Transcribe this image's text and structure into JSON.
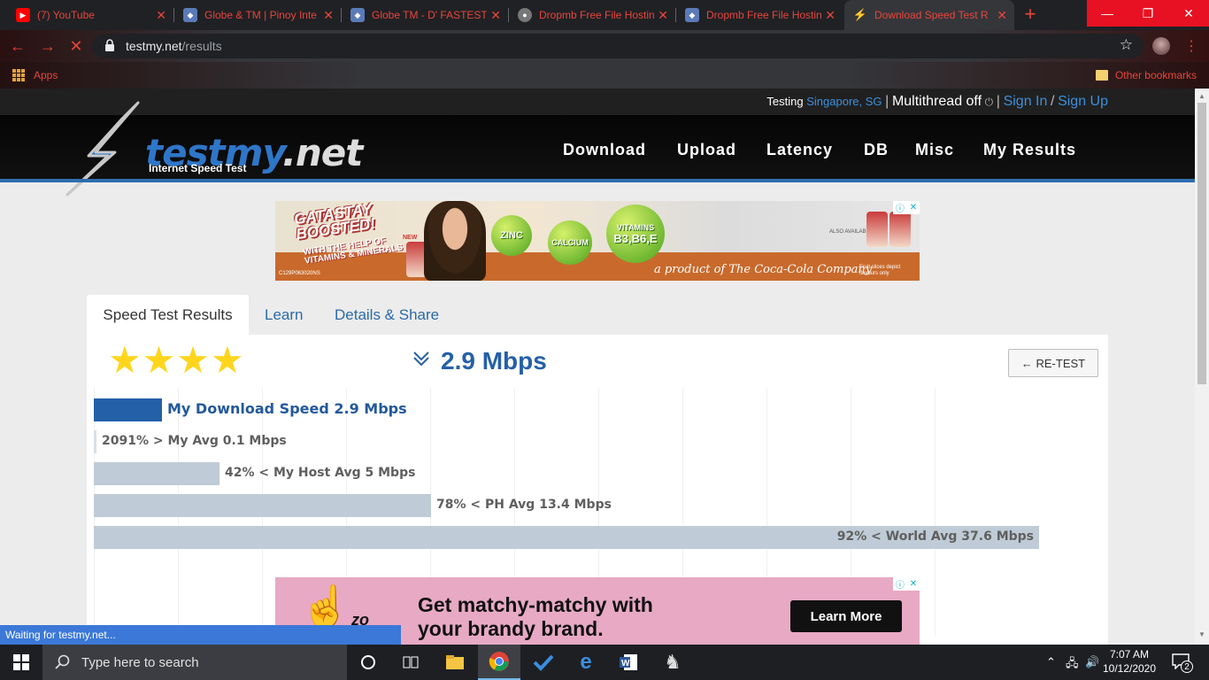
{
  "browser": {
    "tabs": [
      {
        "label": "(7) YouTube",
        "icon": "youtube-icon"
      },
      {
        "label": "Globe & TM | Pinoy Inte",
        "icon": "cube-icon"
      },
      {
        "label": "Globe TM - D' FASTEST",
        "icon": "cube-icon"
      },
      {
        "label": "Dropmb Free File Hostin",
        "icon": "globe-icon"
      },
      {
        "label": "Dropmb Free File Hostin",
        "icon": "cube-icon"
      },
      {
        "label": "Download Speed Test R",
        "icon": "bolt-icon"
      }
    ],
    "url_host": "testmy.net",
    "url_path": "/results",
    "bookmarks": {
      "apps_label": "Apps",
      "other_label": "Other bookmarks"
    },
    "accent_color": "#e8453c"
  },
  "site": {
    "testing_label": "Testing",
    "location": "Singapore, SG",
    "multithread": "Multithread off",
    "sign_in": "Sign In",
    "sign_up": "Sign Up",
    "logo_main": "testmy",
    "logo_tld": ".net",
    "logo_sub": "Internet Speed Test",
    "nav": [
      "Download",
      "Upload",
      "Latency",
      "DB",
      "Misc",
      "My Results"
    ]
  },
  "ad_top": {
    "line1": "GATASTAY",
    "line2": "BOOSTED!",
    "line3": "WITH THE HELP OF",
    "line4": "VITAMINS & MINERALS",
    "new": "NEW",
    "ball1": "ZINC",
    "ball2": "CALCIUM",
    "ball3_a": "VITAMINS",
    "ball3_b": "B3,B6,E",
    "product": "a product of The Coca-Cola Company",
    "code": "C129P063020NS",
    "also": "ALSO AVAILABLE",
    "fruit": "Fruit slices depict flavours only"
  },
  "tabs": [
    "Speed Test Results",
    "Learn",
    "Details & Share"
  ],
  "result": {
    "stars": "★★★★",
    "speed": "2.9 Mbps",
    "retest": "← RE-TEST"
  },
  "chart_data": {
    "type": "bar",
    "categories": [
      "My Download Speed",
      "My Avg",
      "My Host Avg",
      "PH Avg",
      "World Avg"
    ],
    "values": [
      2.9,
      0.1,
      5,
      13.4,
      37.6
    ],
    "unit": "Mbps",
    "labels": [
      "My Download Speed 2.9 Mbps",
      "2091% > My Avg 0.1 Mbps",
      "42% < My Host Avg 5 Mbps",
      "78% < PH Avg 13.4 Mbps",
      "92% < World Avg 37.6 Mbps"
    ],
    "colors": {
      "mine": "#2360a8",
      "compare": "#bfcbd6"
    }
  },
  "ad_bottom": {
    "brand_fragment": "zo",
    "headline_1": "Get matchy-matchy with",
    "headline_2": "your brandy brand.",
    "cta": "Learn More"
  },
  "status_text": "Waiting for testmy.net...",
  "taskbar": {
    "search_placeholder": "Type here to search",
    "time": "7:07 AM",
    "date": "10/12/2020",
    "notifications": "2"
  }
}
